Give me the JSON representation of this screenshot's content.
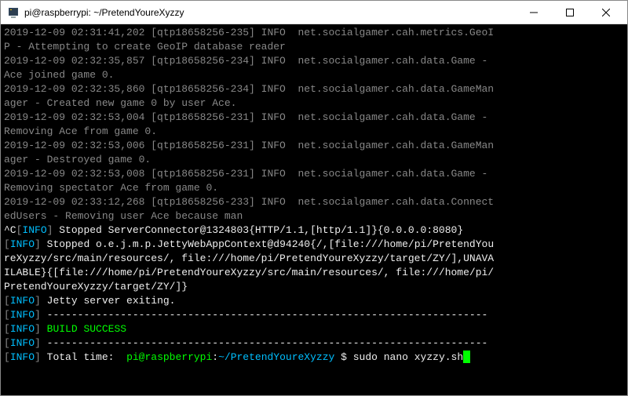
{
  "titlebar": {
    "title": "pi@raspberrypi: ~/PretendYoureXyzzy"
  },
  "log": {
    "l1a": "2019-12-09 02:31:41,202 [qtp18658256-235] INFO  net.socialgamer.cah.metrics.GeoI",
    "l1b": "P - Attempting to create GeoIP database reader",
    "l2a": "2019-12-09 02:32:35,857 [qtp18658256-234] INFO  net.socialgamer.cah.data.Game - ",
    "l2b": "Ace joined game 0.",
    "l3a": "2019-12-09 02:32:35,860 [qtp18658256-234] INFO  net.socialgamer.cah.data.GameMan",
    "l3b": "ager - Created new game 0 by user Ace.",
    "l4a": "2019-12-09 02:32:53,004 [qtp18658256-231] INFO  net.socialgamer.cah.data.Game - ",
    "l4b": "Removing Ace from game 0.",
    "l5a": "2019-12-09 02:32:53,006 [qtp18658256-231] INFO  net.socialgamer.cah.data.GameMan",
    "l5b": "ager - Destroyed game 0.",
    "l6a": "2019-12-09 02:32:53,008 [qtp18658256-231] INFO  net.socialgamer.cah.data.Game - ",
    "l6b": "Removing spectator Ace from game 0.",
    "l7a": "2019-12-09 02:33:12,268 [qtp18658256-233] INFO  net.socialgamer.cah.data.Connect",
    "l7b": "edUsers - Removing user Ace because man",
    "sigC": "^C",
    "lb": "[",
    "rb": "] ",
    "rbNoSpace": "]",
    "INFO": "INFO",
    "stop1": "Stopped ServerConnector@1324803{HTTP/1.1,[http/1.1]}{0.0.0.0:8080}",
    "stop2a": "Stopped o.e.j.m.p.JettyWebAppContext@d94240{/,[file:///home/pi/PretendYou",
    "stop2b": "reXyzzy/src/main/resources/, file:///home/pi/PretendYoureXyzzy/target/ZY/],UNAVA",
    "stop2c": "ILABLE}{[file:///home/pi/PretendYoureXyzzy/src/main/resources/, file:///home/pi/",
    "stop2d": "PretendYoureXyzzy/target/ZY/]}",
    "exiting": "Jetty server exiting.",
    "dash": "------------------------------------------------------------------------",
    "build": "BUILD SUCCESS",
    "totaltime": "Total time:  ",
    "promptUser": "pi@raspberrypi",
    "promptColon": ":",
    "promptPath": "~/PretendYoureXyzzy",
    "promptDollar": " $ ",
    "cmd": "sudo nano xyzzy.sh"
  }
}
